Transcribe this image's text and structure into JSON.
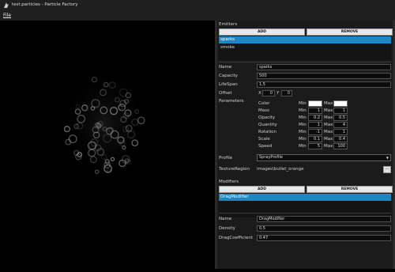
{
  "window": {
    "title": "test.particles - Particle Factory"
  },
  "menu": {
    "file": "File"
  },
  "emitters": {
    "header": "Emitters",
    "add_label": "ADD",
    "remove_label": "REMOVE",
    "items": [
      "sparks",
      "smoke"
    ],
    "selected": "sparks"
  },
  "emitter_props": {
    "name_label": "Name",
    "name_value": "sparks",
    "capacity_label": "Capacity",
    "capacity_value": "500",
    "lifespan_label": "LifeSpan",
    "lifespan_value": "1.5",
    "offset_label": "Offset",
    "offset_x_label": "X",
    "offset_x": "0",
    "offset_y_label": "Y",
    "offset_y": "0",
    "parameters_label": "Parameters",
    "min_label": "Min",
    "max_label": "Max",
    "params": [
      {
        "name": "Color",
        "min": "",
        "max": "",
        "swatch_color": "#ffffff"
      },
      {
        "name": "Mass",
        "min": "1",
        "max": "1"
      },
      {
        "name": "Opacity",
        "min": "0.2",
        "max": "0.5"
      },
      {
        "name": "Quantity",
        "min": "1",
        "max": "4"
      },
      {
        "name": "Rotation",
        "min": "-1",
        "max": "1"
      },
      {
        "name": "Scale",
        "min": "0.1",
        "max": "0.4"
      },
      {
        "name": "Speed",
        "min": "5",
        "max": "100"
      }
    ],
    "profile_label": "Profile",
    "profile_value": "SprayProfile",
    "texture_label": "TextureRegion",
    "texture_value": "images\\bullet_orange",
    "browse_label": "..."
  },
  "modifiers": {
    "header": "Modifiers",
    "add_label": "ADD",
    "remove_label": "REMOVE",
    "items": [
      "DragModifier"
    ],
    "selected": "DragModifier"
  },
  "modifier_props": {
    "name_label": "Name",
    "name_value": "DragModifier",
    "density_label": "Density",
    "density_value": "0.5",
    "dragcoef_label": "DragCoefficient",
    "dragcoef_value": "0.47"
  },
  "colors": {
    "accent": "#1e86c3",
    "panel": "#1b1b1b",
    "canvas": "#000000"
  }
}
